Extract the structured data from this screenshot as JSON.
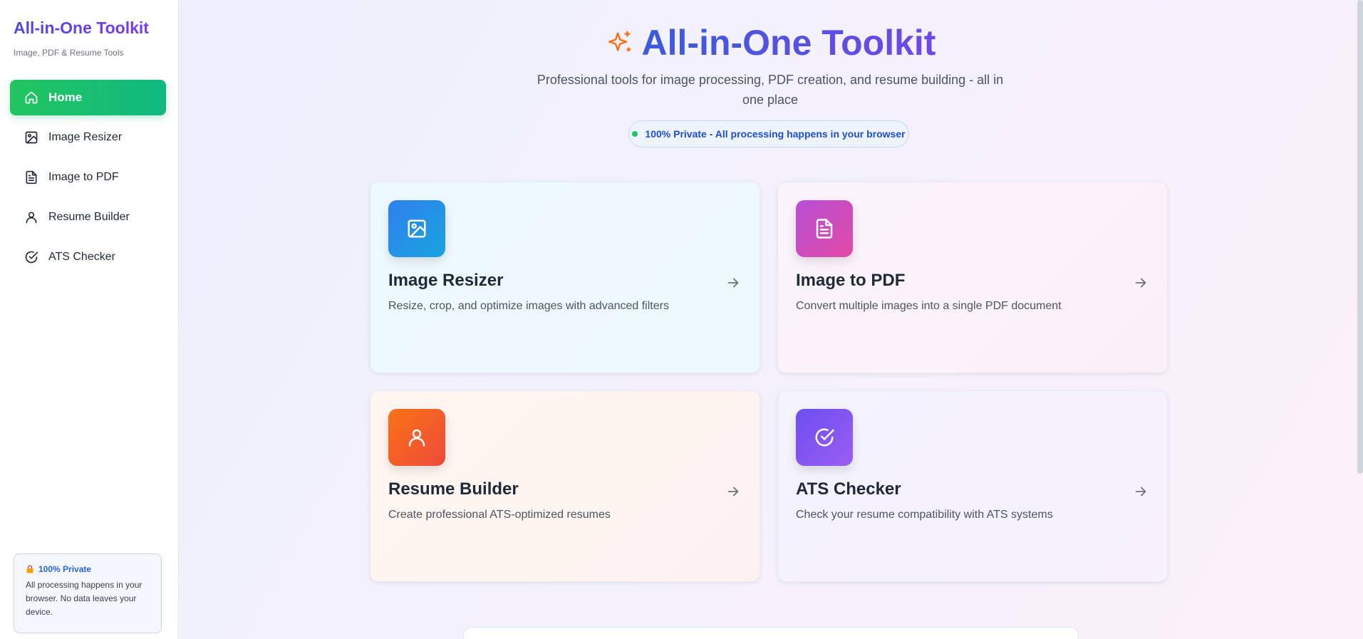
{
  "sidebar": {
    "title": "All-in-One Toolkit",
    "subtitle": "Image, PDF & Resume Tools",
    "items": [
      {
        "label": "Home",
        "icon": "home-icon",
        "active": true
      },
      {
        "label": "Image Resizer",
        "icon": "image-icon"
      },
      {
        "label": "Image to PDF",
        "icon": "document-icon"
      },
      {
        "label": "Resume Builder",
        "icon": "user-icon"
      },
      {
        "label": "ATS Checker",
        "icon": "check-circle-icon"
      }
    ],
    "privacy": {
      "title": "100% Private",
      "text": "All processing happens in your browser. No data leaves your device."
    }
  },
  "hero": {
    "title": "All-in-One Toolkit",
    "subtitle": "Professional tools for image processing, PDF creation, and resume building - all in one place",
    "badge": "100% Private - All processing happens in your browser"
  },
  "tools": [
    {
      "title": "Image Resizer",
      "description": "Resize, crop, and optimize images with advanced filters",
      "icon": "image-icon"
    },
    {
      "title": "Image to PDF",
      "description": "Convert multiple images into a single PDF document",
      "icon": "document-icon"
    },
    {
      "title": "Resume Builder",
      "description": "Create professional ATS-optimized resumes",
      "icon": "user-icon"
    },
    {
      "title": "ATS Checker",
      "description": "Check your resume compatibility with ATS systems",
      "icon": "check-circle-icon"
    }
  ],
  "colors": {
    "accent": "#4f46e5",
    "active_nav": "#22c55e",
    "spark": "#f97316"
  }
}
